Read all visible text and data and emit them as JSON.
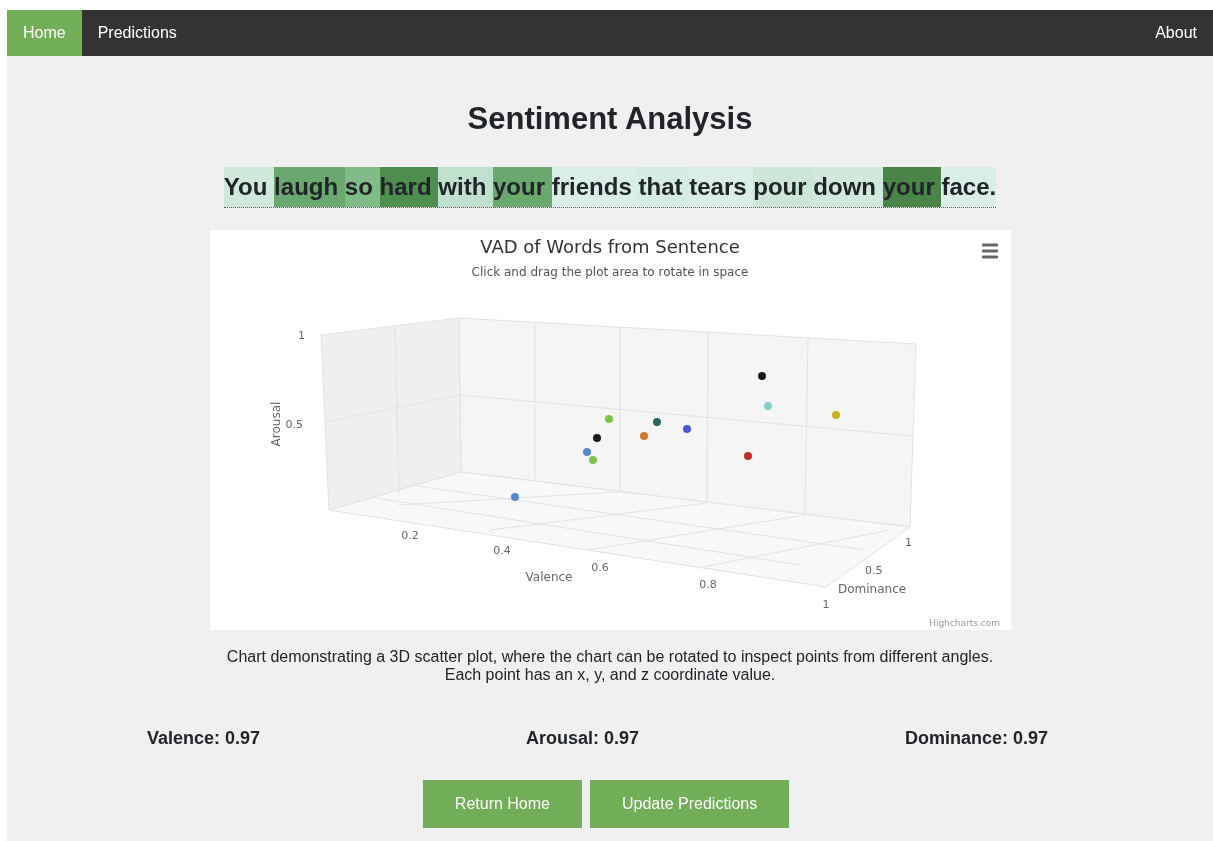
{
  "nav": {
    "left": [
      {
        "label": "Home",
        "selected": true
      },
      {
        "label": "Predictions",
        "selected": false
      }
    ],
    "right": [
      {
        "label": "About",
        "selected": false
      }
    ]
  },
  "title": "Sentiment Analysis",
  "sentence": [
    {
      "word": "You",
      "color": "#cfe8dc"
    },
    {
      "word": "laugh",
      "color": "#6aa86e"
    },
    {
      "word": "so",
      "color": "#80bb88"
    },
    {
      "word": "hard",
      "color": "#4e8e4f"
    },
    {
      "word": "with",
      "color": "#bfe0cc"
    },
    {
      "word": "your",
      "color": "#6aa86e"
    },
    {
      "word": "friends",
      "color": "#d8eee6"
    },
    {
      "word": "that",
      "color": "#d4ece2"
    },
    {
      "word": "tears",
      "color": "#d8eee6"
    },
    {
      "word": "pour",
      "color": "#cce6d8"
    },
    {
      "word": "down",
      "color": "#d0e9dc"
    },
    {
      "word": "your",
      "color": "#4a8448"
    },
    {
      "word": "face.",
      "color": "#d8eee6"
    }
  ],
  "chart": {
    "title": "VAD of Words from Sentence",
    "subtitle": "Click and drag the plot area to rotate in space",
    "credit": "Highcharts.com",
    "y_axis": {
      "title": "Arousal",
      "ticks": [
        "1",
        "0.5"
      ]
    },
    "x_axis": {
      "title": "Valence",
      "ticks": [
        "0.2",
        "0.4",
        "0.6",
        "0.8",
        "1"
      ]
    },
    "z_axis": {
      "title": "Dominance",
      "ticks": [
        "1",
        "0.5"
      ]
    },
    "points": [
      {
        "color": "#5b87d0"
      },
      {
        "color": "#5b87d0"
      },
      {
        "color": "#7cc44a"
      },
      {
        "color": "#1a1a1a"
      },
      {
        "color": "#7cc44a"
      },
      {
        "color": "#d07a30"
      },
      {
        "color": "#2a6560"
      },
      {
        "color": "#4f55d0"
      },
      {
        "color": "#c02a2a"
      },
      {
        "color": "#1a1a1a"
      },
      {
        "color": "#80d0cc"
      },
      {
        "color": "#c8b020"
      }
    ]
  },
  "caption": [
    "Chart demonstrating a 3D scatter plot, where the chart can be rotated to inspect points from different angles.",
    "Each point has an x, y, and z coordinate value."
  ],
  "stats": [
    "Valence: 0.97",
    "Arousal: 0.97",
    "Dominance: 0.97"
  ],
  "buttons": [
    "Return Home",
    "Update Predictions"
  ]
}
